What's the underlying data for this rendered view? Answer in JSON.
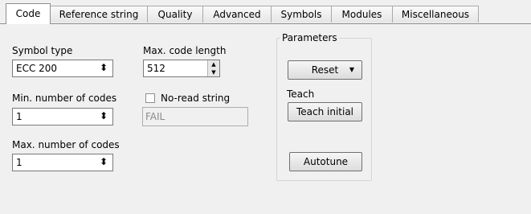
{
  "tabs": [
    {
      "label": "Code"
    },
    {
      "label": "Reference string"
    },
    {
      "label": "Quality"
    },
    {
      "label": "Advanced"
    },
    {
      "label": "Symbols"
    },
    {
      "label": "Modules"
    },
    {
      "label": "Miscellaneous"
    }
  ],
  "active_tab": "Code",
  "symbol_type": {
    "label": "Symbol type",
    "value": "ECC 200"
  },
  "max_code_length": {
    "label": "Max. code length",
    "value": "512"
  },
  "min_codes": {
    "label": "Min. number of codes",
    "value": "1"
  },
  "no_read": {
    "label": "No-read string",
    "checked": false,
    "value": "FAIL"
  },
  "max_codes": {
    "label": "Max. number of codes",
    "value": "1"
  },
  "parameters": {
    "title": "Parameters",
    "reset_label": "Reset",
    "teach_label": "Teach",
    "teach_initial_label": "Teach initial",
    "autotune_label": "Autotune"
  },
  "icons": {
    "combo": "up-down-spinner-icon",
    "dropdown": "dropdown-arrow-icon"
  }
}
